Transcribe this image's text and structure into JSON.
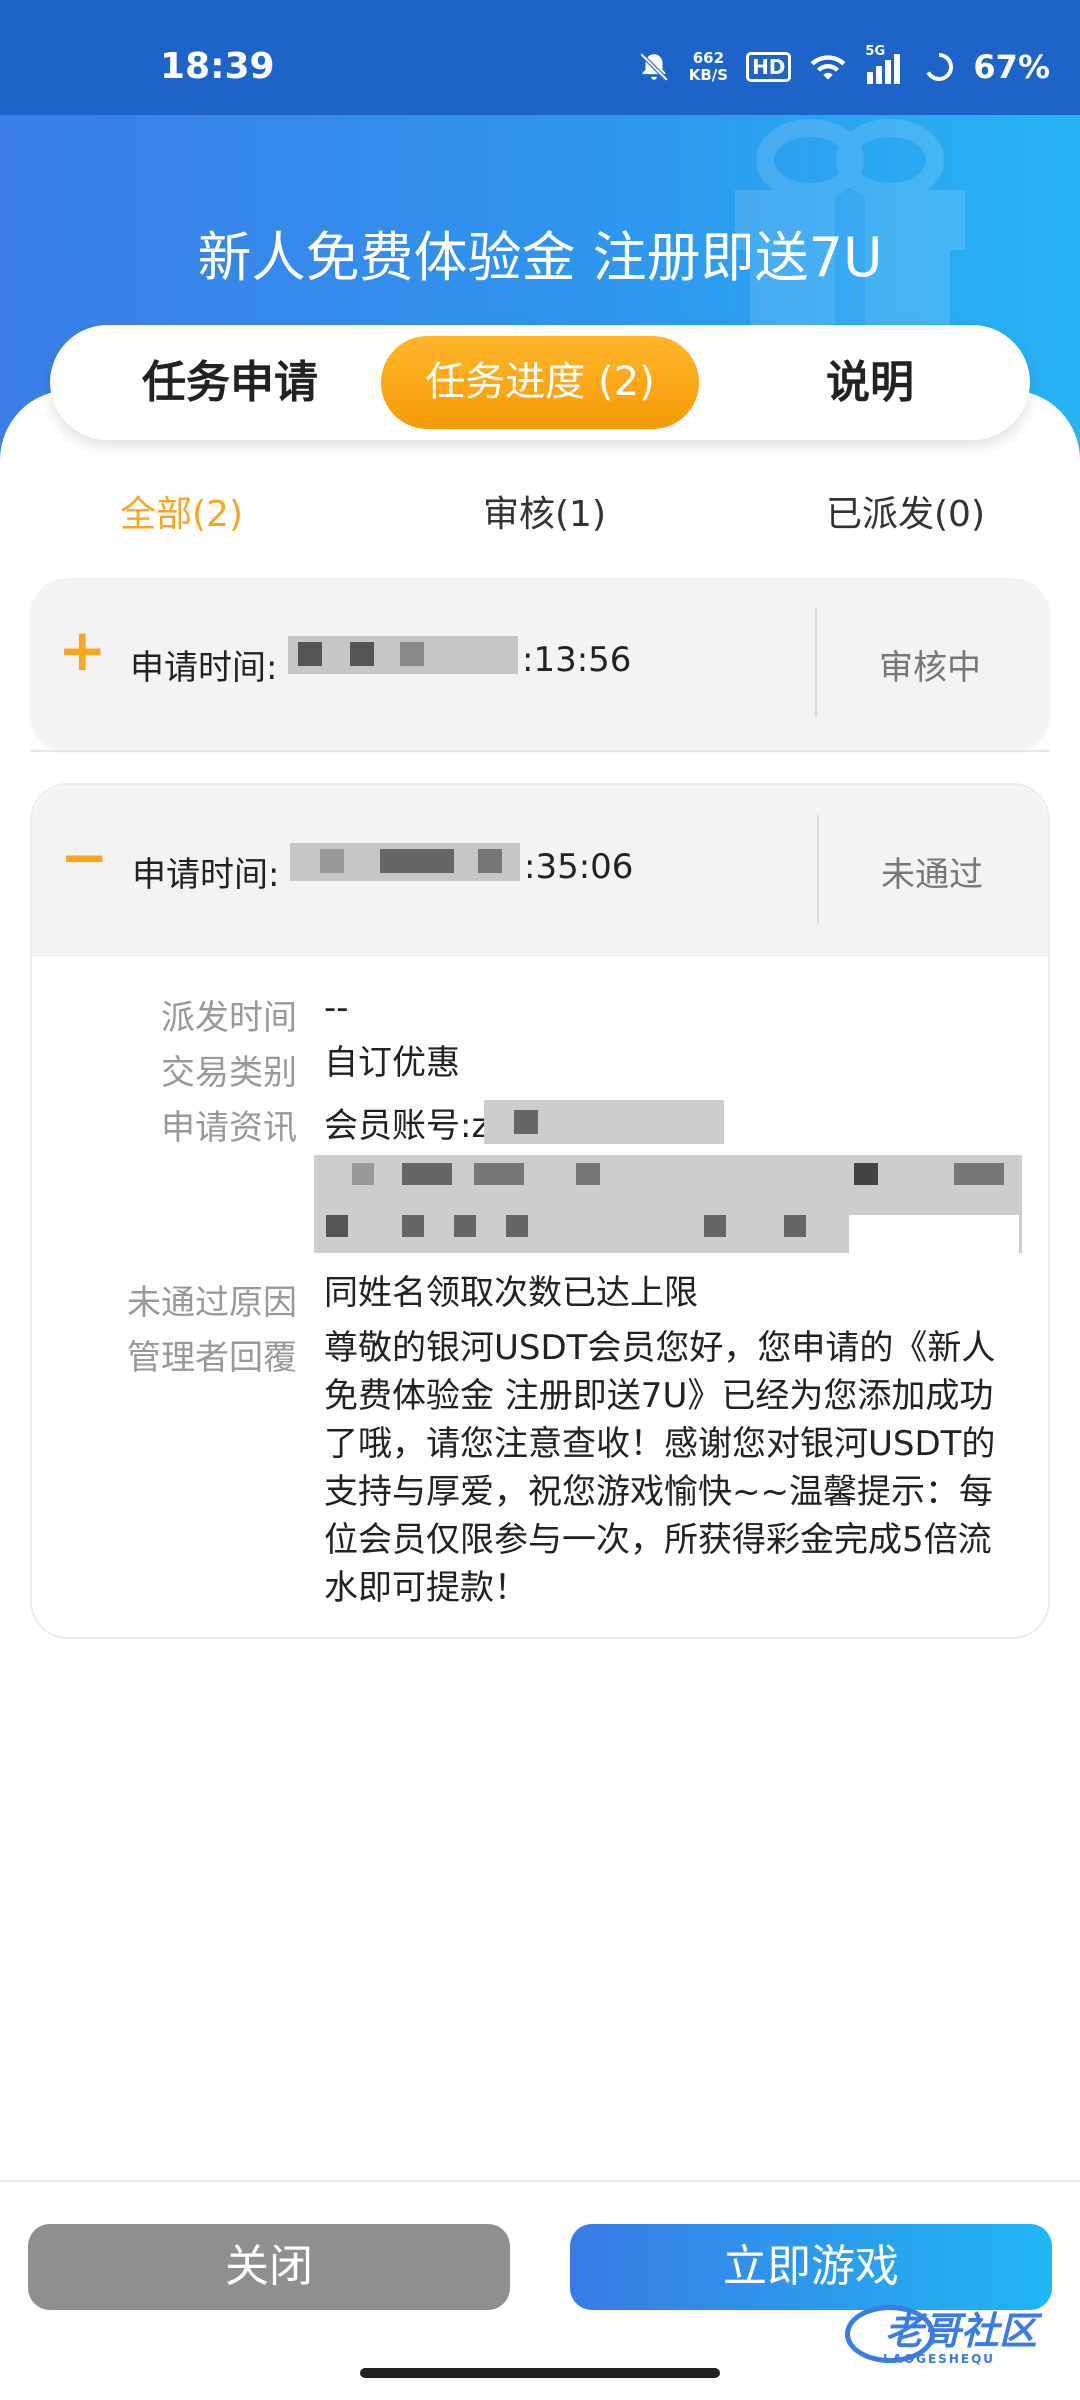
{
  "status_bar": {
    "time": "18:39",
    "speed_value": "662",
    "speed_unit": "KB/S",
    "hd": "HD",
    "network": "5G",
    "battery": "67%"
  },
  "header": {
    "title": "新人免费体验金 注册即送7U"
  },
  "tabs": {
    "apply": "任务申请",
    "progress": "任务进度 (2)",
    "info": "说明"
  },
  "filters": {
    "all": "全部(2)",
    "review": "审核(1)",
    "sent": "已派发(0)"
  },
  "records": [
    {
      "toggle": "+",
      "apply_label": "申请时间:",
      "apply_time": ":13:56",
      "status": "审核中"
    },
    {
      "toggle": "−",
      "apply_label": "申请时间:",
      "apply_time": ":35:06",
      "status": "未通过",
      "details": {
        "dispatch_time_label": "派发时间",
        "dispatch_time": "--",
        "trade_type_label": "交易类别",
        "trade_type": "自订优惠",
        "apply_info_label": "申请资讯",
        "apply_info": "会员账号:z",
        "reject_reason_label": "未通过原因",
        "reject_reason": "同姓名领取次数已达上限",
        "admin_reply_label": "管理者回覆",
        "admin_reply": "尊敬的银河USDT会员您好，您申请的《新人免费体验金 注册即送7U》已经为您添加成功了哦，请您注意查收！感谢您对银河USDT的支持与厚爱，祝您游戏愉快~~温馨提示：每位会员仅限参与一次，所获得彩金完成5倍流水即可提款！"
      }
    }
  ],
  "footer": {
    "close": "关闭",
    "play": "立即游戏"
  },
  "watermark": {
    "text": "老哥社区",
    "sub": "LAOGESHEQU"
  },
  "colors": {
    "accent_orange": "#f5a623",
    "brand_blue": "#2f95ee"
  }
}
